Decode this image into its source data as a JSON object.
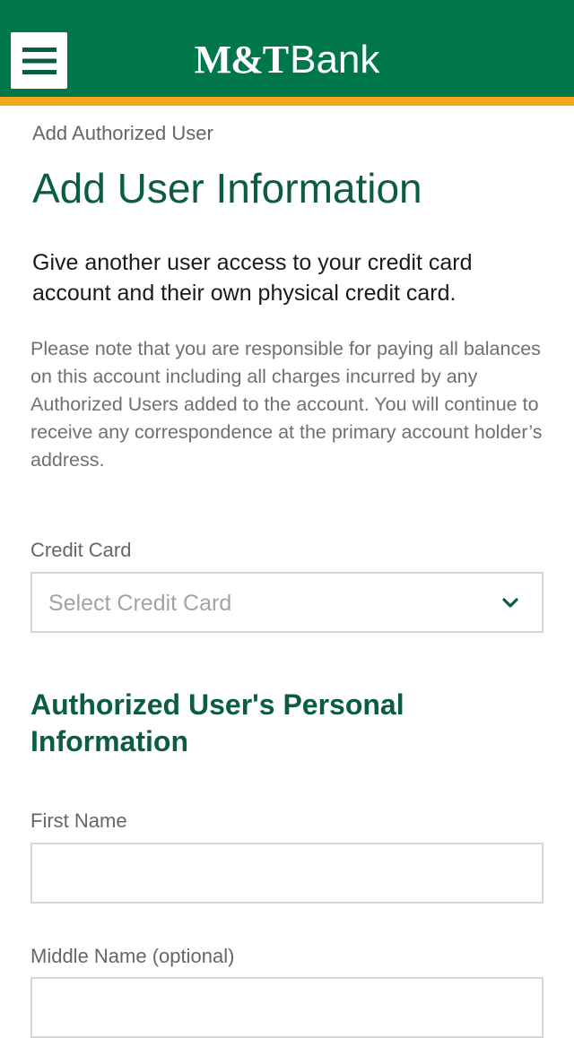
{
  "header": {
    "logo_mt": "M&T",
    "logo_bank": "Bank",
    "menu_icon": "hamburger-menu-icon",
    "brand_green": "#00774b",
    "stripe_gold": "#f3a81f"
  },
  "breadcrumb": "Add Authorized User",
  "page_title": "Add User Information",
  "intro": "Give another user access to your credit card account and their own physical credit card.",
  "note": "Please note that you are responsible for paying all balances on this account including all charges incurred by any Authorized Users added to the account. You will continue to receive any correspondence at the primary account holder’s address.",
  "credit_card": {
    "label": "Credit Card",
    "placeholder": "Select Credit Card",
    "icon": "chevron-down-icon"
  },
  "personal_section": {
    "title": "Authorized User's Personal Information"
  },
  "first_name": {
    "label": "First Name",
    "value": ""
  },
  "middle_name": {
    "label": "Middle Name (optional)",
    "value": ""
  }
}
